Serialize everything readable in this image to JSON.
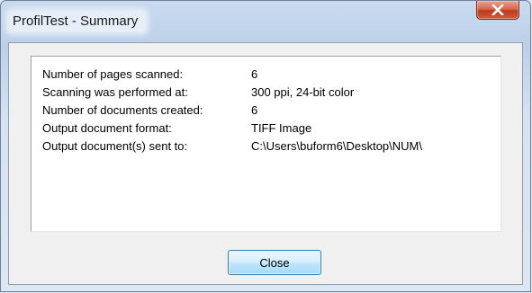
{
  "window": {
    "title": "ProfilTest - Summary"
  },
  "summary": {
    "rows": [
      {
        "label": "Number of pages scanned:",
        "value": "6"
      },
      {
        "label": "Scanning was performed at:",
        "value": "300 ppi, 24-bit color"
      },
      {
        "label": "Number of documents created:",
        "value": "6"
      },
      {
        "label": "Output document format:",
        "value": "TIFF Image"
      },
      {
        "label": "Output document(s) sent to:",
        "value": "C:\\Users\\buform6\\Desktop\\NUM\\"
      }
    ]
  },
  "buttons": {
    "close_label": "Close"
  },
  "icons": {
    "titlebar_close": "close-icon"
  },
  "colors": {
    "close_button_red": "#c1391d",
    "default_button_border": "#3c7fb1"
  }
}
